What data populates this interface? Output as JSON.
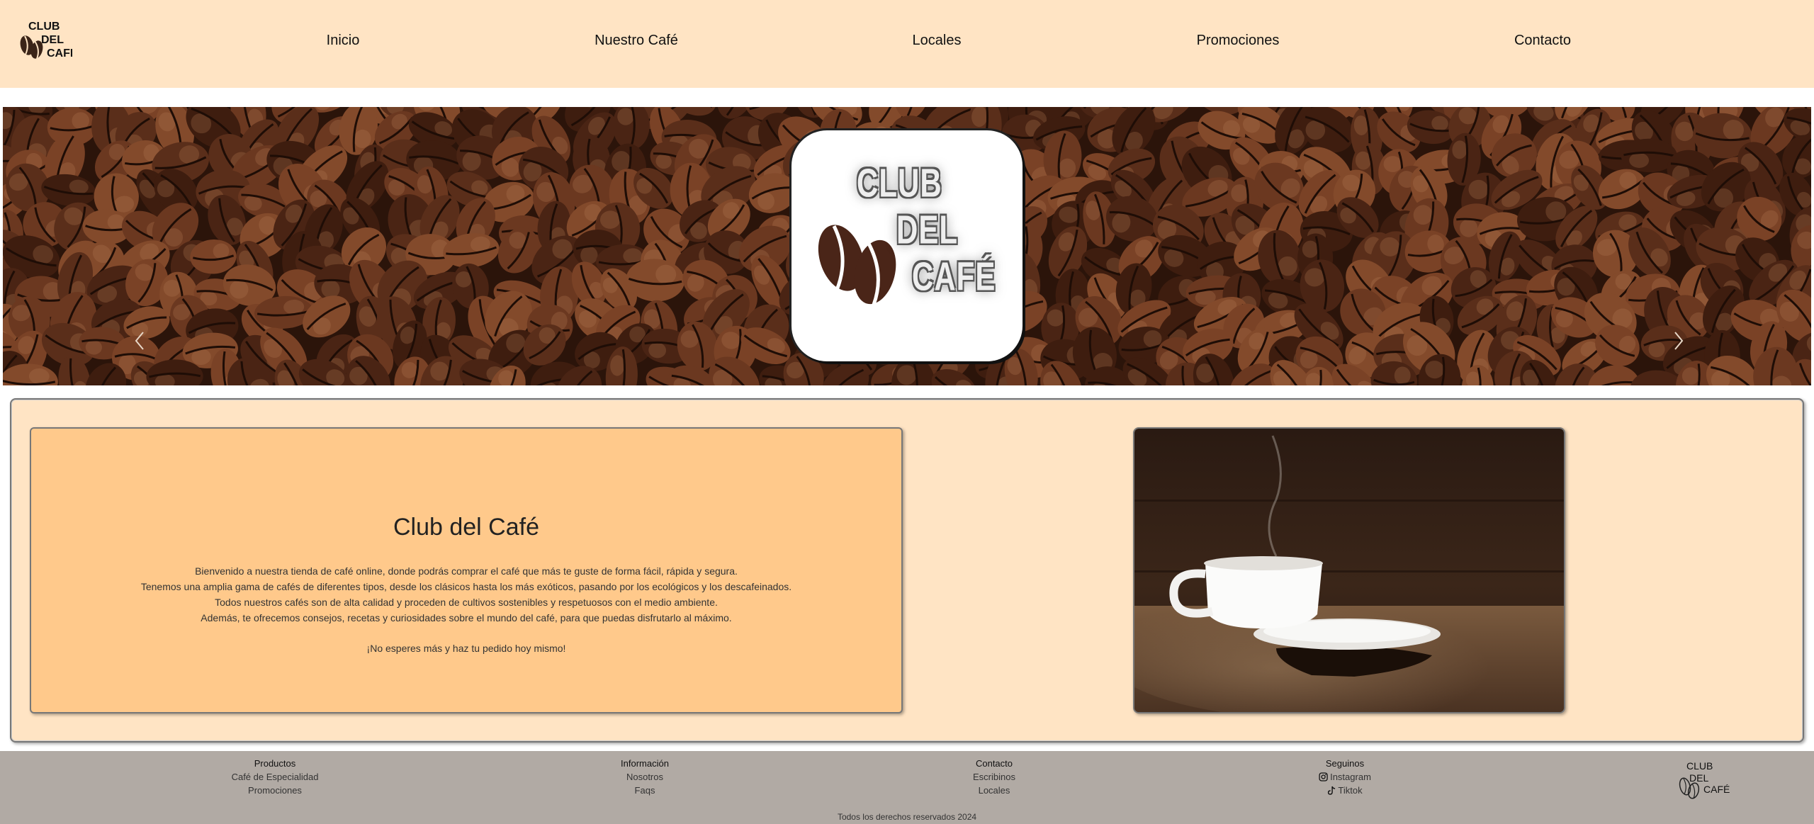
{
  "header": {
    "logo_text": [
      "CLUB",
      "DEL",
      "CAFÉ"
    ],
    "nav": [
      {
        "label": "Inicio"
      },
      {
        "label": "Nuestro Café"
      },
      {
        "label": "Locales"
      },
      {
        "label": "Promociones"
      },
      {
        "label": "Contacto"
      }
    ]
  },
  "hero": {
    "logo_text": [
      "CLUB",
      "DEL",
      "CAFÉ"
    ],
    "prev_icon": "chevron-left-icon",
    "next_icon": "chevron-right-icon"
  },
  "intro": {
    "title": "Club del Café",
    "lines": [
      "Bienvenido a nuestra tienda de café online, donde podrás comprar el café que más te guste de forma fácil, rápida y segura.",
      "Tenemos una amplia gama de cafés de diferentes tipos, desde los clásicos hasta los más exóticos, pasando por los ecológicos y los descafeinados.",
      "Todos nuestros cafés son de alta calidad y proceden de cultivos sostenibles y respetuosos con el medio ambiente.",
      "Además, te ofrecemos consejos, recetas y curiosidades sobre el mundo del café, para que puedas disfrutarlo al máximo."
    ],
    "cta": "¡No esperes más y haz tu pedido hoy mismo!"
  },
  "footer": {
    "columns": [
      {
        "heading": "Productos",
        "links": [
          "Café de Especialidad",
          "Promociones"
        ]
      },
      {
        "heading": "Información",
        "links": [
          "Nosotros",
          "Faqs"
        ]
      },
      {
        "heading": "Contacto",
        "links": [
          "Escribinos",
          "Locales"
        ]
      },
      {
        "heading": "Seguinos",
        "links": [
          "Instagram",
          "Tiktok"
        ]
      }
    ],
    "logo_text": [
      "CLUB",
      "DEL",
      "CAFÉ"
    ],
    "copyright": "Todos los derechos reservados 2024"
  },
  "colors": {
    "header_bg": "#ffe4c4",
    "intro_card_bg": "#ffc98b",
    "footer_bg": "#b1aaa4",
    "bean_brown": "#5a2e1a"
  }
}
